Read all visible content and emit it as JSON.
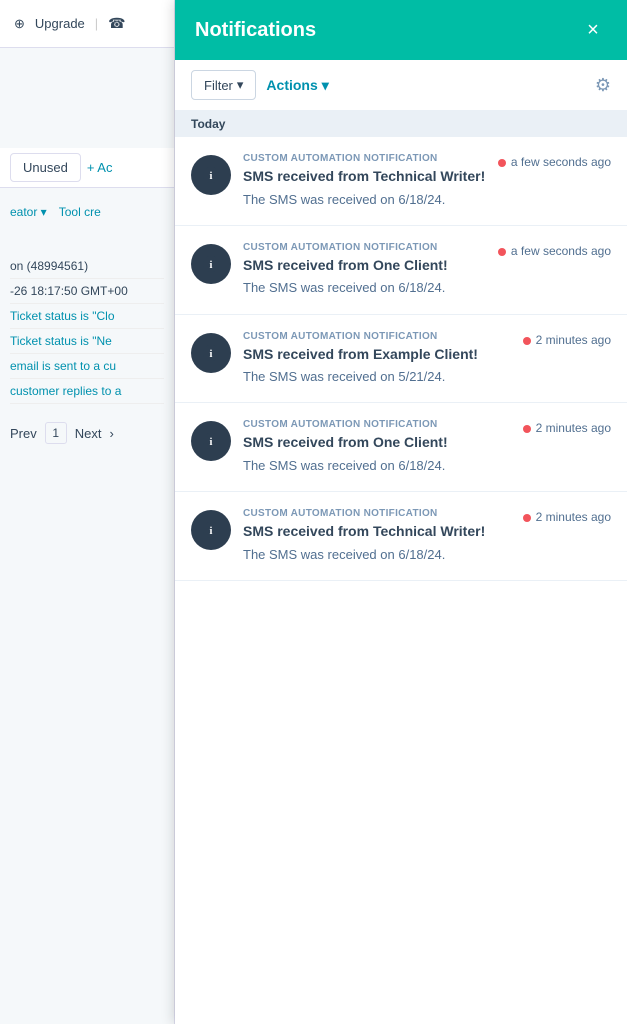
{
  "background": {
    "upgrade_label": "Upgrade",
    "tab_unused": "Unused",
    "tab_add": "+ Ac",
    "tool_creator": "eator ▾",
    "tool_creator2": "Tool cre",
    "list_item1": "on (48994561)",
    "list_item2": "-26 18:17:50 GMT+00",
    "list_item3": "Ticket status is \"Clo",
    "list_item4": "Ticket status is \"Ne",
    "list_item5": "email is sent to a cu",
    "list_item6": "customer replies to a",
    "prev_label": "Prev",
    "page_num": "1",
    "next_label": "Next"
  },
  "panel": {
    "title": "Notifications",
    "close_label": "×",
    "filter_label": "Filter",
    "actions_label": "Actions",
    "section_today": "Today",
    "notifications": [
      {
        "type": "CUSTOM AUTOMATION NOTIFICATION",
        "headline": "SMS received from Technical Writer!",
        "description": "The SMS was received on 6/18/24.",
        "time": "a few seconds ago",
        "unread": true
      },
      {
        "type": "CUSTOM AUTOMATION NOTIFICATION",
        "headline": "SMS received from One Client!",
        "description": "The SMS was received on 6/18/24.",
        "time": "a few seconds ago",
        "unread": true
      },
      {
        "type": "CUSTOM AUTOMATION NOTIFICATION",
        "headline": "SMS received from Example Client!",
        "description": "The SMS was received on 5/21/24.",
        "time": "2 minutes ago",
        "unread": true
      },
      {
        "type": "CUSTOM AUTOMATION NOTIFICATION",
        "headline": "SMS received from One Client!",
        "description": "The SMS was received on 6/18/24.",
        "time": "2 minutes ago",
        "unread": true
      },
      {
        "type": "CUSTOM AUTOMATION NOTIFICATION",
        "headline": "SMS received from Technical Writer!",
        "description": "The SMS was received on 6/18/24.",
        "time": "2 minutes ago",
        "unread": true
      }
    ]
  }
}
